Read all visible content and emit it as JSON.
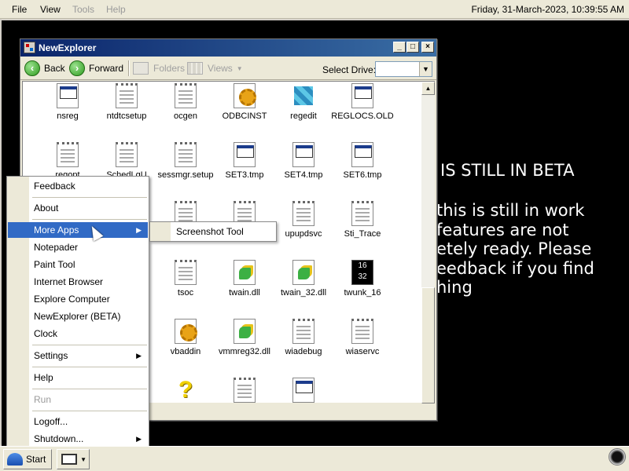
{
  "topbar": {
    "menus": [
      {
        "label": "File",
        "enabled": true
      },
      {
        "label": "View",
        "enabled": true
      },
      {
        "label": "Tools",
        "enabled": false
      },
      {
        "label": "Help",
        "enabled": false
      }
    ],
    "clock": "Friday, 31-March-2023, 10:39:55 AM"
  },
  "background_text": {
    "title": "S IS STILL IN BETA",
    "lines": [
      "this is still in work",
      "features are not",
      "etely ready. Please",
      "eedback if you find",
      "hing"
    ]
  },
  "window": {
    "title": "NewExplorer",
    "toolbar": {
      "back": "Back",
      "forward": "Forward",
      "folders": "Folders",
      "views": "Views",
      "select_drive_label": "Select Drive:",
      "select_drive_value": ""
    },
    "files": [
      {
        "name": "nsreg",
        "icon": "window-app-icon"
      },
      {
        "name": "ntdtcsetup",
        "icon": "text-file-icon"
      },
      {
        "name": "ocgen",
        "icon": "text-file-icon"
      },
      {
        "name": "ODBCINST",
        "icon": "settings-file-icon"
      },
      {
        "name": "regedit",
        "icon": "regedit-icon"
      },
      {
        "name": "REGLOCS.OLD",
        "icon": "window-app-icon"
      },
      {
        "name": "regopt",
        "icon": "text-file-icon"
      },
      {
        "name": "SchedLgU",
        "icon": "text-file-icon"
      },
      {
        "name": "sessmgr.setup",
        "icon": "text-file-icon"
      },
      {
        "name": "SET3.tmp",
        "icon": "window-app-icon"
      },
      {
        "name": "SET4.tmp",
        "icon": "window-app-icon"
      },
      {
        "name": "SET6.tmp",
        "icon": "window-app-icon"
      },
      {
        "name": "",
        "icon": "text-file-icon"
      },
      {
        "name": "",
        "icon": "text-file-icon"
      },
      {
        "name": "",
        "icon": "text-file-icon"
      },
      {
        "name": "",
        "icon": "text-file-icon"
      },
      {
        "name": "upupdsvc",
        "icon": "text-file-icon"
      },
      {
        "name": "Sti_Trace",
        "icon": "text-file-icon"
      },
      {
        "name": "",
        "icon": "text-file-icon"
      },
      {
        "name": "",
        "icon": "text-file-icon"
      },
      {
        "name": "tsoc",
        "icon": "text-file-icon"
      },
      {
        "name": "twain.dll",
        "icon": "dll-file-icon"
      },
      {
        "name": "twain_32.dll",
        "icon": "dll-file-icon"
      },
      {
        "name": "twunk_16",
        "icon": "twunk-icon"
      },
      {
        "name": "",
        "icon": "text-file-icon"
      },
      {
        "name": "",
        "icon": "text-file-icon"
      },
      {
        "name": "vbaddin",
        "icon": "settings-file-icon"
      },
      {
        "name": "vmmreg32.dll",
        "icon": "dll-file-icon"
      },
      {
        "name": "wiadebug",
        "icon": "text-file-icon"
      },
      {
        "name": "wiaservc",
        "icon": "text-file-icon"
      },
      {
        "name": "",
        "icon": "text-file-icon"
      },
      {
        "name": "",
        "icon": "text-file-icon"
      },
      {
        "name": "",
        "icon": "question-icon"
      },
      {
        "name": "",
        "icon": "text-file-icon"
      },
      {
        "name": "",
        "icon": "window-app-icon"
      }
    ]
  },
  "start_menu": {
    "items": [
      {
        "label": "Feedback",
        "enabled": true,
        "submenu": false,
        "highlighted": false
      },
      {
        "label": "About",
        "enabled": true,
        "submenu": false,
        "highlighted": false
      },
      {
        "label": "More Apps",
        "enabled": true,
        "submenu": true,
        "highlighted": true
      },
      {
        "label": "Notepader",
        "enabled": true,
        "submenu": false,
        "highlighted": false
      },
      {
        "label": "Paint Tool",
        "enabled": true,
        "submenu": false,
        "highlighted": false
      },
      {
        "label": "Internet Browser",
        "enabled": true,
        "submenu": false,
        "highlighted": false
      },
      {
        "label": "Explore Computer",
        "enabled": true,
        "submenu": false,
        "highlighted": false
      },
      {
        "label": "NewExplorer (BETA)",
        "enabled": true,
        "submenu": false,
        "highlighted": false
      },
      {
        "label": "Clock",
        "enabled": true,
        "submenu": false,
        "highlighted": false
      },
      {
        "label": "Settings",
        "enabled": true,
        "submenu": true,
        "highlighted": false
      },
      {
        "label": "Help",
        "enabled": true,
        "submenu": false,
        "highlighted": false
      },
      {
        "label": "Run",
        "enabled": false,
        "submenu": false,
        "highlighted": false
      },
      {
        "label": "Logoff...",
        "enabled": true,
        "submenu": false,
        "highlighted": false
      },
      {
        "label": "Shutdown...",
        "enabled": true,
        "submenu": true,
        "highlighted": false
      }
    ],
    "submenu_items": [
      "Screenshot Tool"
    ]
  },
  "taskbar": {
    "start_label": "Start"
  }
}
